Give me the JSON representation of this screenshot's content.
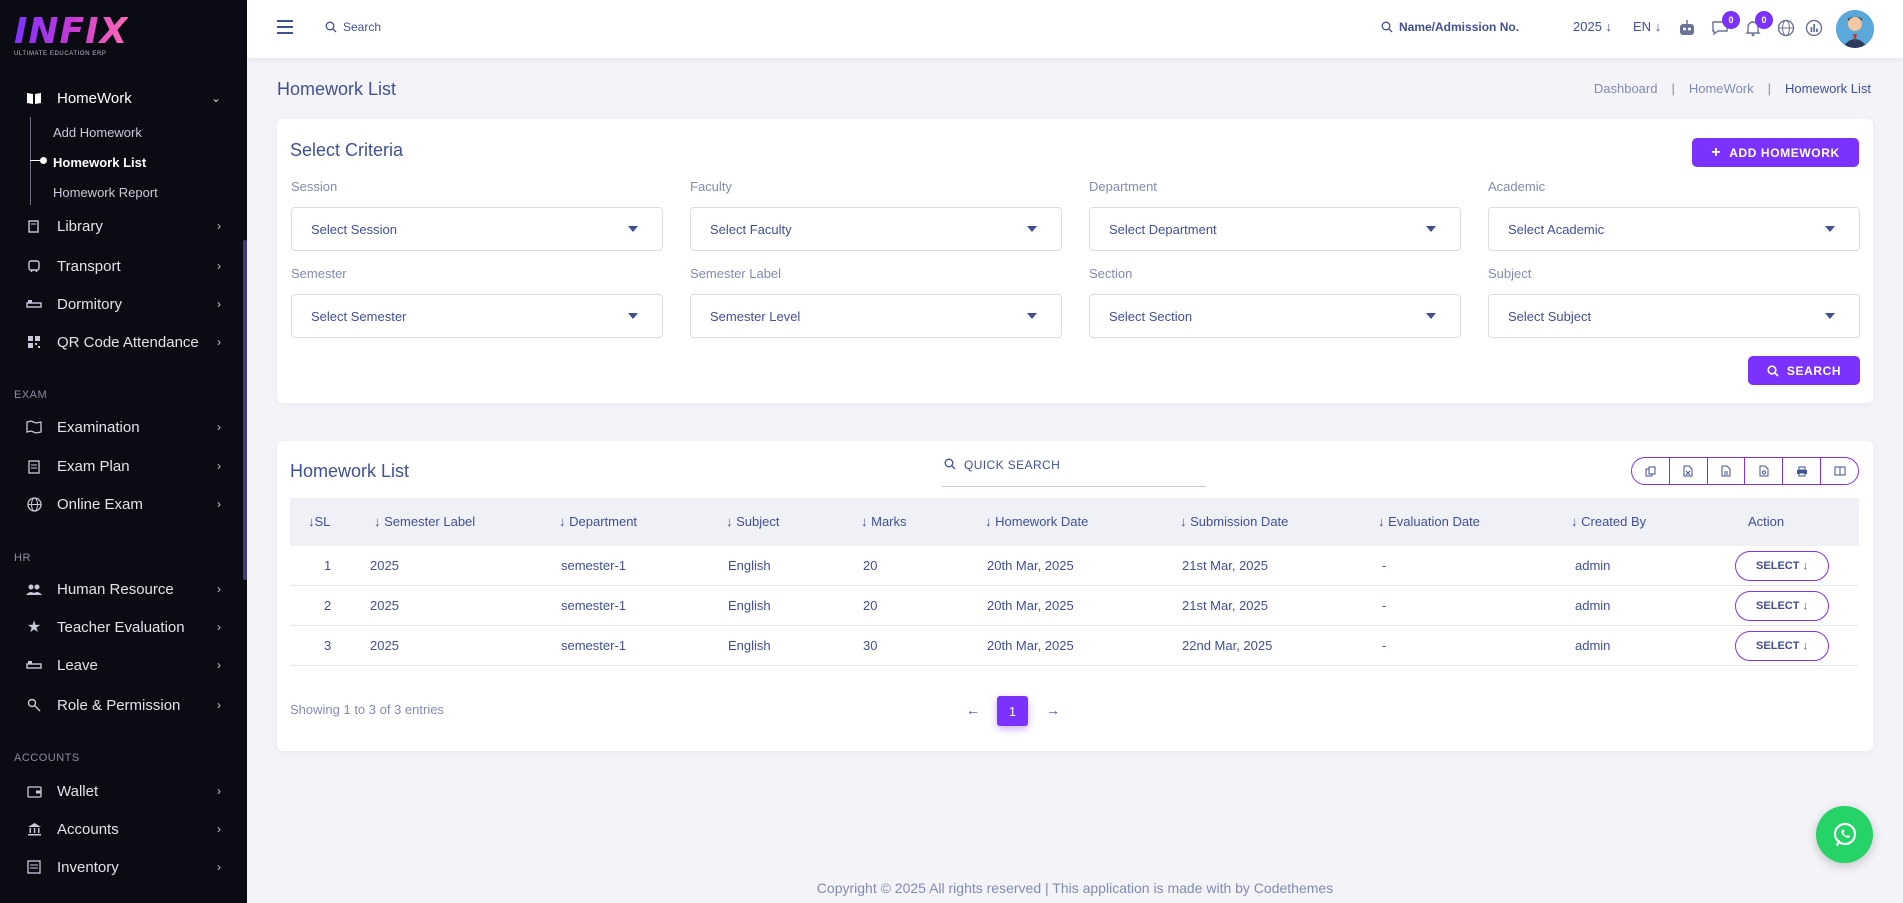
{
  "brand": {
    "name": "INFIX",
    "tagline": "ULTIMATE EDUCATION ERP"
  },
  "sidebar": {
    "homework": {
      "label": "HomeWork",
      "icon": "book-open-icon",
      "subitems": [
        {
          "label": "Add Homework"
        },
        {
          "label": "Homework List"
        },
        {
          "label": "Homework Report"
        }
      ]
    },
    "items_top": [
      {
        "label": "Library",
        "icon": "library-icon"
      },
      {
        "label": "Transport",
        "icon": "bus-icon"
      },
      {
        "label": "Dormitory",
        "icon": "bed-icon"
      },
      {
        "label": "QR Code Attendance",
        "icon": "qr-code-icon"
      }
    ],
    "section_exam": "EXAM",
    "items_exam": [
      {
        "label": "Examination",
        "icon": "map-icon"
      },
      {
        "label": "Exam Plan",
        "icon": "clipboard-icon"
      },
      {
        "label": "Online Exam",
        "icon": "globe-icon"
      }
    ],
    "section_hr": "HR",
    "items_hr": [
      {
        "label": "Human Resource",
        "icon": "users-icon"
      },
      {
        "label": "Teacher Evaluation",
        "icon": "star-icon"
      },
      {
        "label": "Leave",
        "icon": "bed-icon"
      },
      {
        "label": "Role & Permission",
        "icon": "key-icon"
      }
    ],
    "section_accounts": "ACCOUNTS",
    "items_accounts": [
      {
        "label": "Wallet",
        "icon": "wallet-icon"
      },
      {
        "label": "Accounts",
        "icon": "bank-icon"
      },
      {
        "label": "Inventory",
        "icon": "inventory-icon"
      }
    ]
  },
  "topbar": {
    "search_label": "Search",
    "name_search_label": "Name/Admission No.",
    "year": "2025",
    "language": "EN",
    "messages_count": "0",
    "notifications_count": "0"
  },
  "page": {
    "title": "Homework List",
    "breadcrumb": [
      "Dashboard",
      "HomeWork",
      "Homework List"
    ]
  },
  "criteria": {
    "title": "Select Criteria",
    "add_button": "ADD HOMEWORK",
    "search_button": "SEARCH",
    "fields": [
      {
        "label": "Session",
        "value": "Select Session"
      },
      {
        "label": "Faculty",
        "value": "Select Faculty"
      },
      {
        "label": "Department",
        "value": "Select Department"
      },
      {
        "label": "Academic",
        "value": "Select Academic"
      },
      {
        "label": "Semester",
        "value": "Select Semester"
      },
      {
        "label": "Semester Label",
        "value": "Semester Level"
      },
      {
        "label": "Section",
        "value": "Select Section"
      },
      {
        "label": "Subject",
        "value": "Select Subject"
      }
    ]
  },
  "list": {
    "title": "Homework List",
    "quick_search": "QUICK SEARCH",
    "columns": [
      "SL",
      "Semester Label",
      "Department",
      "Subject",
      "Marks",
      "Homework Date",
      "Submission Date",
      "Evaluation Date",
      "Created By",
      "Action"
    ],
    "rows": [
      {
        "sl": "1",
        "semester_label": "2025",
        "department": "semester-1",
        "subject": "English",
        "marks": "20",
        "homework_date": "20th Mar, 2025",
        "submission_date": "21st Mar, 2025",
        "evaluation_date": "-",
        "created_by": "admin",
        "action": "SELECT"
      },
      {
        "sl": "2",
        "semester_label": "2025",
        "department": "semester-1",
        "subject": "English",
        "marks": "20",
        "homework_date": "20th Mar, 2025",
        "submission_date": "21st Mar, 2025",
        "evaluation_date": "-",
        "created_by": "admin",
        "action": "SELECT"
      },
      {
        "sl": "3",
        "semester_label": "2025",
        "department": "semester-1",
        "subject": "English",
        "marks": "30",
        "homework_date": "20th Mar, 2025",
        "submission_date": "22nd Mar, 2025",
        "evaluation_date": "-",
        "created_by": "admin",
        "action": "SELECT"
      }
    ],
    "showing": "Showing 1 to 3 of 3 entries",
    "current_page": "1"
  },
  "footer": {
    "text": "Copyright © 2025 All rights reserved | This application is made with by Codethemes"
  },
  "colors": {
    "accent": "#7c32ff",
    "sidebar_bg": "#0b0b14",
    "text": "#415094",
    "whatsapp": "#25d366"
  }
}
